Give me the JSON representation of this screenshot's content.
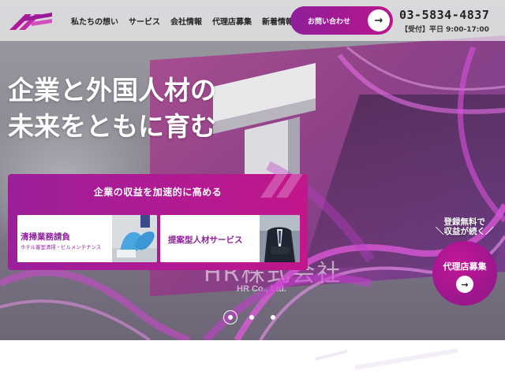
{
  "header": {
    "nav": [
      "私たちの想い",
      "サービス",
      "会社情報",
      "代理店募集",
      "新着情報"
    ],
    "contact_label": "お問い合わせ",
    "phone": "03-5834-4837",
    "hours": "【受付】平日 9:00-17:00"
  },
  "hero": {
    "headline_line1": "企業と外国人材の",
    "headline_line2": "未来をともに育む",
    "sign_text": "HR株式会社",
    "sign_sub": "HR Co., Ltd."
  },
  "services": {
    "title": "企業の収益を加速的に高める",
    "cards": [
      {
        "title": "清掃業務請負",
        "sub": "ホテル客室清掃・ビルメンテナンス"
      },
      {
        "title": "提案型人材サービス",
        "sub": ""
      }
    ]
  },
  "agent": {
    "note_line1": "登録無料で",
    "note_line2": "＼収益が続く／",
    "label": "代理店募集"
  },
  "slider": {
    "count": 3,
    "active": 1
  },
  "colors": {
    "brand_purple": "#8e1f9a",
    "brand_magenta": "#c2168c",
    "text_dark": "#222222"
  }
}
